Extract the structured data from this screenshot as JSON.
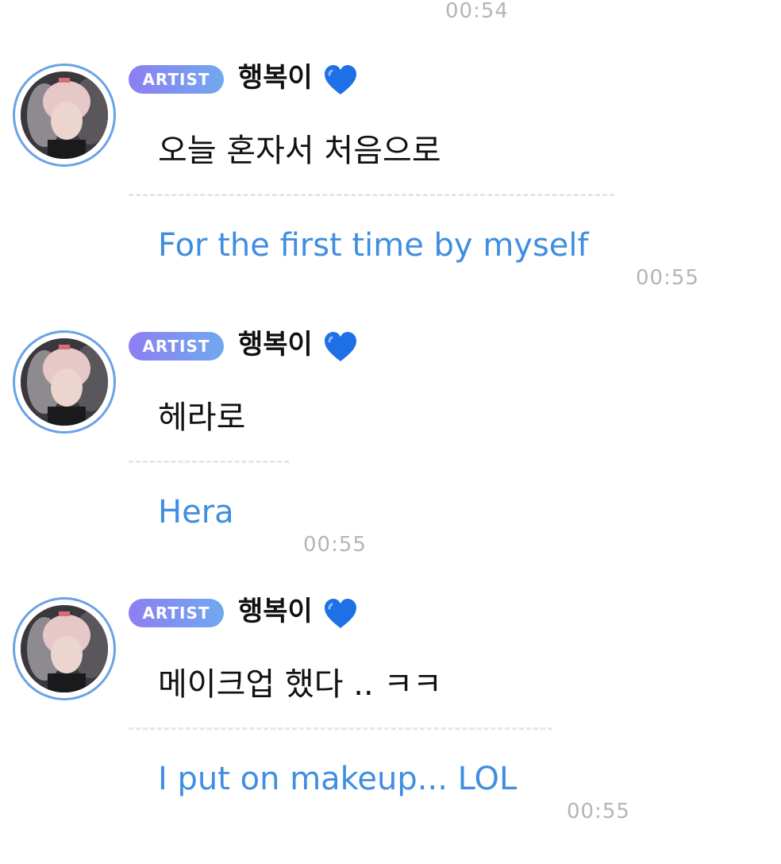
{
  "top_timestamp": "00:54",
  "messages": [
    {
      "badge": "ARTIST",
      "name": "행복이",
      "heart_icon": "blue-heart-icon",
      "korean": "오늘 혼자서 처음으로",
      "english": "For the first time by myself",
      "time": "00:55"
    },
    {
      "badge": "ARTIST",
      "name": "행복이",
      "heart_icon": "blue-heart-icon",
      "korean": "헤라로",
      "english": "Hera",
      "time": "00:55"
    },
    {
      "badge": "ARTIST",
      "name": "행복이",
      "heart_icon": "blue-heart-icon",
      "korean": "메이크업 했다 .. ㅋㅋ",
      "english": "I put on makeup... LOL",
      "time": "00:55"
    }
  ],
  "colors": {
    "avatar_ring": "#6aa2e6",
    "badge_start": "#8e7ef2",
    "badge_end": "#6fa9ef",
    "translation_text": "#3f8ee0",
    "timestamp": "#b5b5b5",
    "heart": "#1f6fe6"
  }
}
